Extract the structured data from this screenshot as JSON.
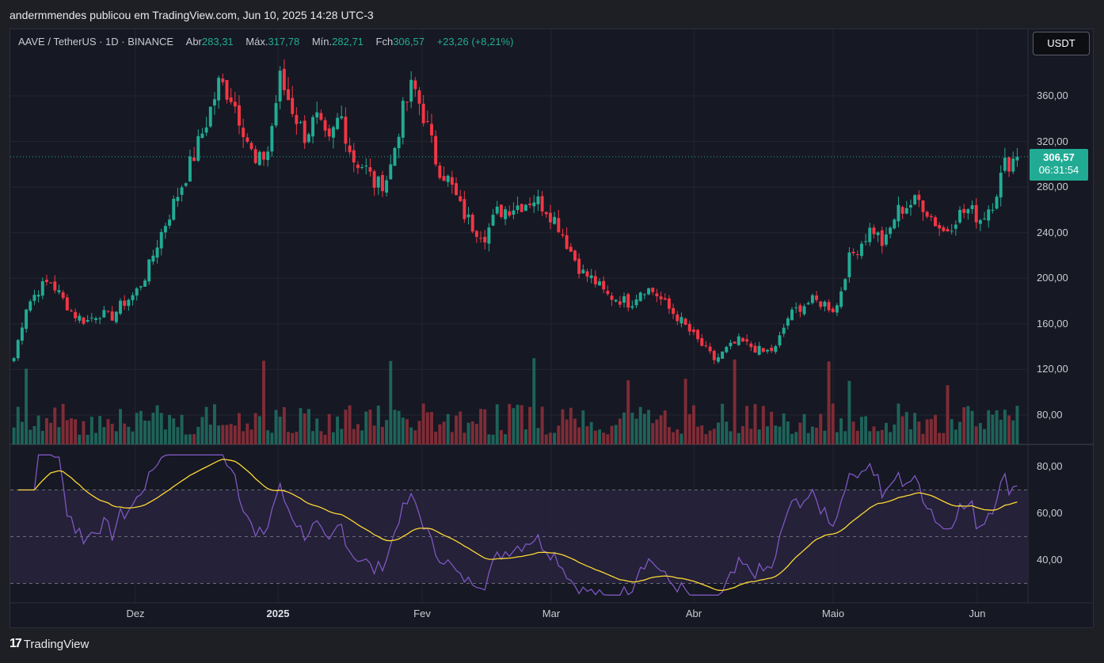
{
  "header": {
    "publisher": "andermmendes publicou em TradingView.com, Jun 10, 2025 14:28 UTC-3"
  },
  "legend": {
    "symbol": "AAVE / TetherUS · 1D · BINANCE",
    "open_label": "Abr",
    "open": "283,31",
    "high_label": "Máx.",
    "high": "317,78",
    "low_label": "Mín.",
    "low": "282,71",
    "close_label": "Fch",
    "close": "306,57",
    "change": "+23,26 (+8,21%)"
  },
  "currency_button": "USDT",
  "last_price": {
    "price": "306,57",
    "countdown": "06:31:54"
  },
  "price_axis": [
    "360,00",
    "320,00",
    "280,00",
    "240,00",
    "200,00",
    "160,00",
    "120,00",
    "80,00"
  ],
  "rsi_axis": [
    "80,00",
    "60,00",
    "40,00"
  ],
  "date_axis": [
    {
      "label": "Dez",
      "bold": false
    },
    {
      "label": "2025",
      "bold": true
    },
    {
      "label": "Fev",
      "bold": false
    },
    {
      "label": "Mar",
      "bold": false
    },
    {
      "label": "Abr",
      "bold": false
    },
    {
      "label": "Maio",
      "bold": false
    },
    {
      "label": "Jun",
      "bold": false
    }
  ],
  "footer": {
    "logo": "17",
    "brand": "TradingView"
  },
  "colors": {
    "up": "#22ab94",
    "down": "#f23645",
    "rsi": "#7e57c2",
    "rsi_ma": "#fdd835",
    "bg": "#161823"
  },
  "chart_data": {
    "type": "candlestick",
    "title": "AAVE / TetherUS · 1D · BINANCE",
    "ylim": [
      60,
      400
    ],
    "close_path": [
      130,
      175,
      190,
      198,
      182,
      168,
      162,
      170,
      165,
      178,
      186,
      205,
      235,
      260,
      285,
      310,
      340,
      372,
      360,
      332,
      298,
      312,
      375,
      350,
      325,
      340,
      315,
      345,
      305,
      298,
      280,
      290,
      340,
      370,
      340,
      300,
      285,
      260,
      245,
      238,
      258,
      262,
      265,
      270,
      262,
      248,
      225,
      205,
      198,
      185,
      182,
      178,
      192,
      188,
      175,
      165,
      152,
      140,
      128,
      138,
      145,
      140,
      135,
      138,
      165,
      175,
      180,
      178,
      172,
      215,
      230,
      245,
      228,
      258,
      265,
      268,
      252,
      240,
      255,
      260,
      252,
      268,
      300,
      306.57
    ],
    "rsi": {
      "upper": 70,
      "lower": 30,
      "mid": 50,
      "ylim": [
        20,
        90
      ]
    }
  }
}
